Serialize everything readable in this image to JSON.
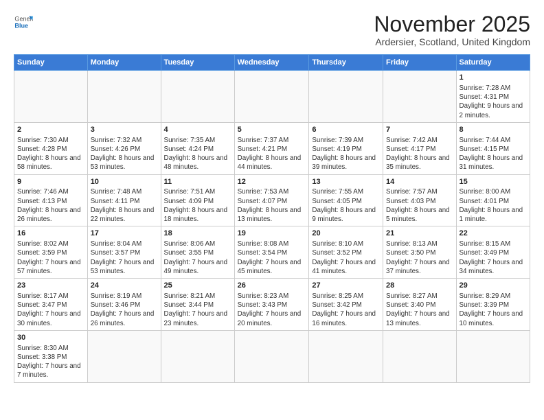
{
  "logo": {
    "general": "General",
    "blue": "Blue"
  },
  "title": "November 2025",
  "subtitle": "Ardersier, Scotland, United Kingdom",
  "days_of_week": [
    "Sunday",
    "Monday",
    "Tuesday",
    "Wednesday",
    "Thursday",
    "Friday",
    "Saturday"
  ],
  "weeks": [
    [
      {
        "day": "",
        "info": ""
      },
      {
        "day": "",
        "info": ""
      },
      {
        "day": "",
        "info": ""
      },
      {
        "day": "",
        "info": ""
      },
      {
        "day": "",
        "info": ""
      },
      {
        "day": "",
        "info": ""
      },
      {
        "day": "1",
        "info": "Sunrise: 7:28 AM\nSunset: 4:31 PM\nDaylight: 9 hours\nand 2 minutes."
      }
    ],
    [
      {
        "day": "2",
        "info": "Sunrise: 7:30 AM\nSunset: 4:28 PM\nDaylight: 8 hours\nand 58 minutes."
      },
      {
        "day": "3",
        "info": "Sunrise: 7:32 AM\nSunset: 4:26 PM\nDaylight: 8 hours\nand 53 minutes."
      },
      {
        "day": "4",
        "info": "Sunrise: 7:35 AM\nSunset: 4:24 PM\nDaylight: 8 hours\nand 48 minutes."
      },
      {
        "day": "5",
        "info": "Sunrise: 7:37 AM\nSunset: 4:21 PM\nDaylight: 8 hours\nand 44 minutes."
      },
      {
        "day": "6",
        "info": "Sunrise: 7:39 AM\nSunset: 4:19 PM\nDaylight: 8 hours\nand 39 minutes."
      },
      {
        "day": "7",
        "info": "Sunrise: 7:42 AM\nSunset: 4:17 PM\nDaylight: 8 hours\nand 35 minutes."
      },
      {
        "day": "8",
        "info": "Sunrise: 7:44 AM\nSunset: 4:15 PM\nDaylight: 8 hours\nand 31 minutes."
      }
    ],
    [
      {
        "day": "9",
        "info": "Sunrise: 7:46 AM\nSunset: 4:13 PM\nDaylight: 8 hours\nand 26 minutes."
      },
      {
        "day": "10",
        "info": "Sunrise: 7:48 AM\nSunset: 4:11 PM\nDaylight: 8 hours\nand 22 minutes."
      },
      {
        "day": "11",
        "info": "Sunrise: 7:51 AM\nSunset: 4:09 PM\nDaylight: 8 hours\nand 18 minutes."
      },
      {
        "day": "12",
        "info": "Sunrise: 7:53 AM\nSunset: 4:07 PM\nDaylight: 8 hours\nand 13 minutes."
      },
      {
        "day": "13",
        "info": "Sunrise: 7:55 AM\nSunset: 4:05 PM\nDaylight: 8 hours\nand 9 minutes."
      },
      {
        "day": "14",
        "info": "Sunrise: 7:57 AM\nSunset: 4:03 PM\nDaylight: 8 hours\nand 5 minutes."
      },
      {
        "day": "15",
        "info": "Sunrise: 8:00 AM\nSunset: 4:01 PM\nDaylight: 8 hours\nand 1 minute."
      }
    ],
    [
      {
        "day": "16",
        "info": "Sunrise: 8:02 AM\nSunset: 3:59 PM\nDaylight: 7 hours\nand 57 minutes."
      },
      {
        "day": "17",
        "info": "Sunrise: 8:04 AM\nSunset: 3:57 PM\nDaylight: 7 hours\nand 53 minutes."
      },
      {
        "day": "18",
        "info": "Sunrise: 8:06 AM\nSunset: 3:55 PM\nDaylight: 7 hours\nand 49 minutes."
      },
      {
        "day": "19",
        "info": "Sunrise: 8:08 AM\nSunset: 3:54 PM\nDaylight: 7 hours\nand 45 minutes."
      },
      {
        "day": "20",
        "info": "Sunrise: 8:10 AM\nSunset: 3:52 PM\nDaylight: 7 hours\nand 41 minutes."
      },
      {
        "day": "21",
        "info": "Sunrise: 8:13 AM\nSunset: 3:50 PM\nDaylight: 7 hours\nand 37 minutes."
      },
      {
        "day": "22",
        "info": "Sunrise: 8:15 AM\nSunset: 3:49 PM\nDaylight: 7 hours\nand 34 minutes."
      }
    ],
    [
      {
        "day": "23",
        "info": "Sunrise: 8:17 AM\nSunset: 3:47 PM\nDaylight: 7 hours\nand 30 minutes."
      },
      {
        "day": "24",
        "info": "Sunrise: 8:19 AM\nSunset: 3:46 PM\nDaylight: 7 hours\nand 26 minutes."
      },
      {
        "day": "25",
        "info": "Sunrise: 8:21 AM\nSunset: 3:44 PM\nDaylight: 7 hours\nand 23 minutes."
      },
      {
        "day": "26",
        "info": "Sunrise: 8:23 AM\nSunset: 3:43 PM\nDaylight: 7 hours\nand 20 minutes."
      },
      {
        "day": "27",
        "info": "Sunrise: 8:25 AM\nSunset: 3:42 PM\nDaylight: 7 hours\nand 16 minutes."
      },
      {
        "day": "28",
        "info": "Sunrise: 8:27 AM\nSunset: 3:40 PM\nDaylight: 7 hours\nand 13 minutes."
      },
      {
        "day": "29",
        "info": "Sunrise: 8:29 AM\nSunset: 3:39 PM\nDaylight: 7 hours\nand 10 minutes."
      }
    ],
    [
      {
        "day": "30",
        "info": "Sunrise: 8:30 AM\nSunset: 3:38 PM\nDaylight: 7 hours\nand 7 minutes."
      },
      {
        "day": "",
        "info": ""
      },
      {
        "day": "",
        "info": ""
      },
      {
        "day": "",
        "info": ""
      },
      {
        "day": "",
        "info": ""
      },
      {
        "day": "",
        "info": ""
      },
      {
        "day": "",
        "info": ""
      }
    ]
  ]
}
